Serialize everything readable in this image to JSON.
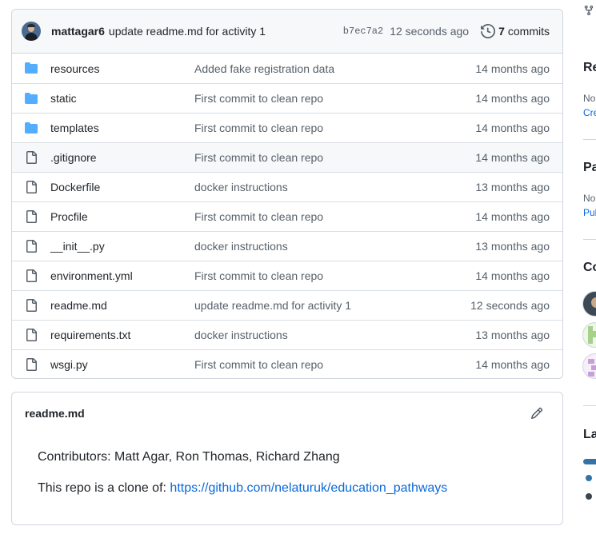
{
  "commit": {
    "author": "mattagar6",
    "message": "update readme.md for activity 1",
    "sha": "b7ec7a2",
    "time": "12 seconds ago",
    "commits_count": "7",
    "commits_label": "commits"
  },
  "files": [
    {
      "name": "resources",
      "type": "folder",
      "message": "Added fake registration data",
      "time": "14 months ago"
    },
    {
      "name": "static",
      "type": "folder",
      "message": "First commit to clean repo",
      "time": "14 months ago"
    },
    {
      "name": "templates",
      "type": "folder",
      "message": "First commit to clean repo",
      "time": "14 months ago"
    },
    {
      "name": ".gitignore",
      "type": "file",
      "message": "First commit to clean repo",
      "time": "14 months ago"
    },
    {
      "name": "Dockerfile",
      "type": "file",
      "message": "docker instructions",
      "time": "13 months ago"
    },
    {
      "name": "Procfile",
      "type": "file",
      "message": "First commit to clean repo",
      "time": "14 months ago"
    },
    {
      "name": "__init__.py",
      "type": "file",
      "message": "docker instructions",
      "time": "13 months ago"
    },
    {
      "name": "environment.yml",
      "type": "file",
      "message": "First commit to clean repo",
      "time": "14 months ago"
    },
    {
      "name": "readme.md",
      "type": "file",
      "message": "update readme.md for activity 1",
      "time": "12 seconds ago"
    },
    {
      "name": "requirements.txt",
      "type": "file",
      "message": "docker instructions",
      "time": "13 months ago"
    },
    {
      "name": "wsgi.py",
      "type": "file",
      "message": "First commit to clean repo",
      "time": "14 months ago"
    }
  ],
  "readme": {
    "title": "readme.md",
    "contributors_line": "Contributors: Matt Agar, Ron Thomas, Richard Zhang",
    "clone_prefix": "This repo is a clone of: ",
    "clone_link": "https://github.com/nelaturuk/education_pathways"
  },
  "sidebar": {
    "releases_heading": "Re",
    "releases_text": "No",
    "releases_link": "Cre",
    "packages_heading": "Pa",
    "packages_text": "No",
    "packages_link": "Pub",
    "contributors_heading": "Co",
    "languages_heading": "La"
  },
  "colors": {
    "link": "#0969da",
    "folder_icon": "#54aeff",
    "muted_text": "#57606a",
    "border": "#d0d7de",
    "python_language": "#3572A5"
  },
  "icons": {
    "commit_history": "history-icon",
    "folder": "folder-icon",
    "file": "file-icon",
    "edit": "pencil-icon",
    "fork": "fork-icon"
  }
}
